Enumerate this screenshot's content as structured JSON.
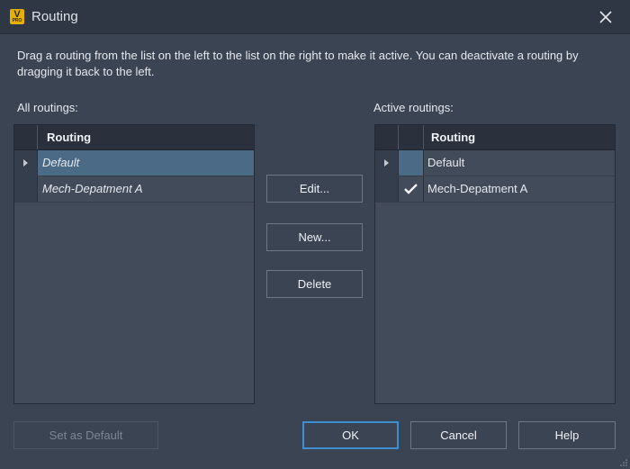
{
  "window": {
    "title": "Routing",
    "app_icon_letter": "V",
    "app_icon_sub": "PRO"
  },
  "description": "Drag a routing from the list on the left to the list on the right to make it active. You can deactivate a routing by dragging it back to the left.",
  "all_routings": {
    "label": "All routings:",
    "column_header": "Routing",
    "rows": [
      {
        "name": "Default",
        "selected": true
      },
      {
        "name": "Mech-Depatment A",
        "selected": false
      }
    ]
  },
  "active_routings": {
    "label": "Active routings:",
    "column_header": "Routing",
    "rows": [
      {
        "name": "Default",
        "checked": false
      },
      {
        "name": "Mech-Depatment A",
        "checked": true
      }
    ]
  },
  "buttons": {
    "edit": "Edit...",
    "new": "New...",
    "delete": "Delete",
    "set_default": "Set as Default",
    "ok": "OK",
    "cancel": "Cancel",
    "help": "Help"
  },
  "colors": {
    "accent": "#3d8fd1",
    "selection": "#4a6a86",
    "background": "#3b4453"
  }
}
